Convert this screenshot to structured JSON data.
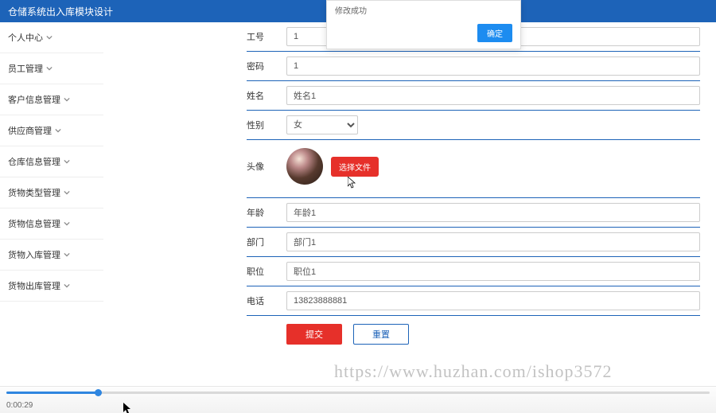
{
  "header": {
    "title": "仓储系统出入库模块设计"
  },
  "sidebar": {
    "items": [
      {
        "label": "个人中心"
      },
      {
        "label": "员工管理"
      },
      {
        "label": "客户信息管理"
      },
      {
        "label": "供应商管理"
      },
      {
        "label": "仓库信息管理"
      },
      {
        "label": "货物类型管理"
      },
      {
        "label": "货物信息管理"
      },
      {
        "label": "货物入库管理"
      },
      {
        "label": "货物出库管理"
      }
    ]
  },
  "modal": {
    "message": "修改成功",
    "ok": "确定"
  },
  "form": {
    "gonghao": {
      "label": "工号",
      "value": "1"
    },
    "mima": {
      "label": "密码",
      "value": "1"
    },
    "xingming": {
      "label": "姓名",
      "value": "姓名1"
    },
    "xingbie": {
      "label": "性别",
      "value": "女"
    },
    "touxiang": {
      "label": "头像",
      "button": "选择文件"
    },
    "nianling": {
      "label": "年龄",
      "value": "年龄1"
    },
    "bumen": {
      "label": "部门",
      "value": "部门1"
    },
    "zhiwei": {
      "label": "职位",
      "value": "职位1"
    },
    "dianhua": {
      "label": "电话",
      "value": "13823888881"
    },
    "submit": "提交",
    "reset": "重置"
  },
  "watermark": "https://www.huzhan.com/ishop3572",
  "player": {
    "time": "0:00:29"
  }
}
